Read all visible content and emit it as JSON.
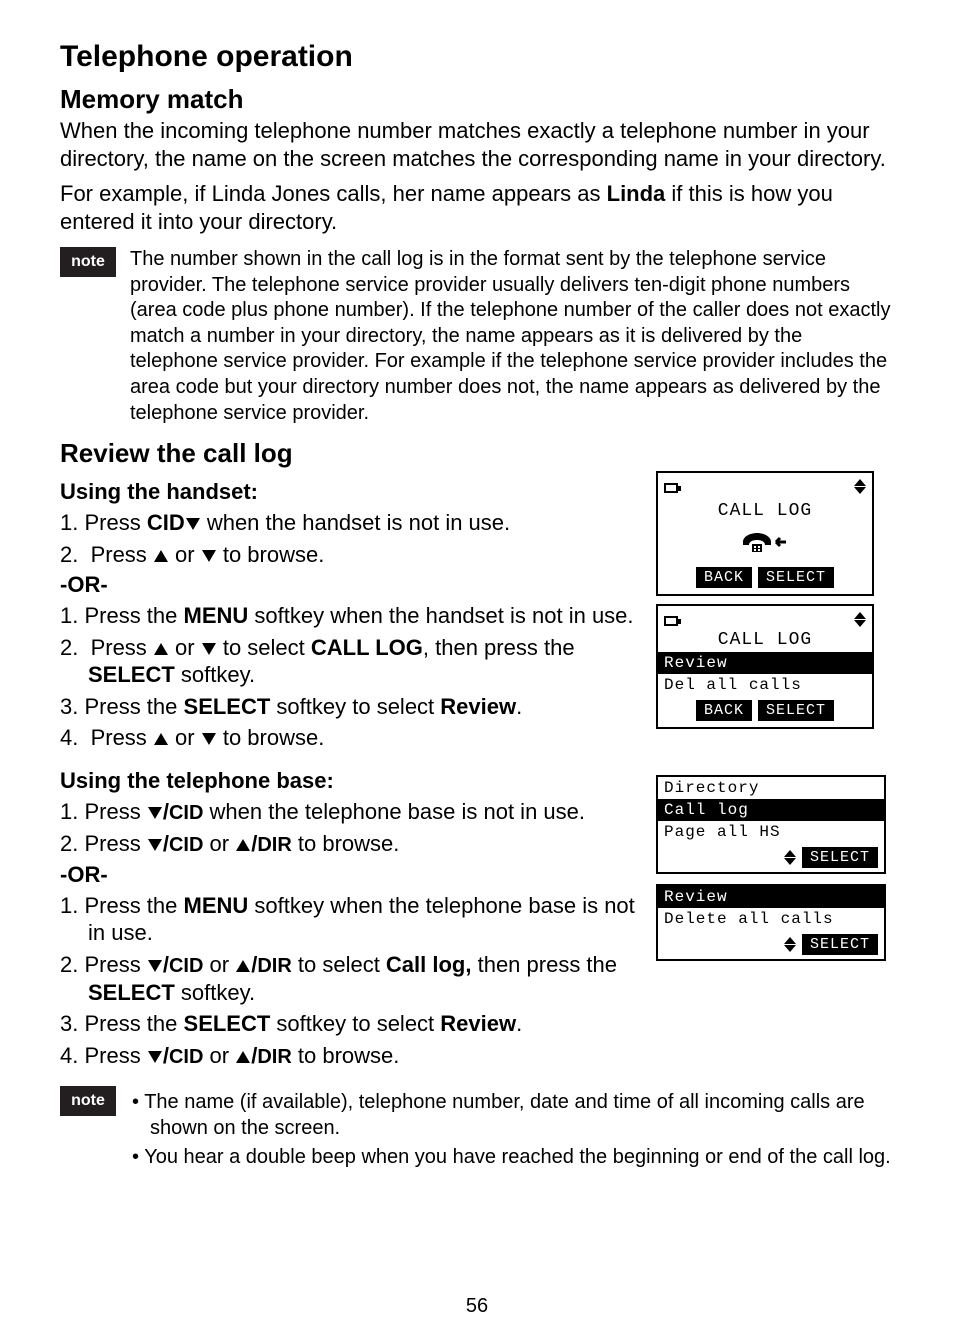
{
  "page_number": "56",
  "title": "Telephone operation",
  "section1": {
    "heading": "Memory match",
    "para1": "When the incoming telephone number matches exactly a telephone number in your directory, the name on the screen matches the corresponding name in your directory.",
    "para2_pre": "For example, if Linda Jones calls, her name appears as ",
    "para2_bold": "Linda",
    "para2_post": " if this is how you entered it into your directory."
  },
  "note1": {
    "label": "note",
    "text": "The number shown in the call log is in the format sent by the telephone service provider. The telephone service provider usually delivers ten-digit phone numbers (area code plus phone number). If the telephone number of the caller does not exactly match a number in your directory, the name appears as it is delivered by the telephone service provider. For example if the telephone service provider includes the area code but your directory number does not, the name appears as delivered by the telephone service provider."
  },
  "section2": {
    "heading": "Review the call log",
    "handset_heading": "Using the handset:",
    "h_step1_pre": "1.  Press ",
    "h_step1_bold": "CID",
    "h_step1_post": " when the handset is not in use.",
    "h_step2": "2.  Press ▲ or ▼ to browse.",
    "or": "-OR-",
    "h_alt1_pre": "1.  Press the ",
    "h_alt1_bold": "MENU",
    "h_alt1_post": " softkey when the handset is not in use.",
    "h_alt2_pre": "2.  Press ▲ or ▼ to select ",
    "h_alt2_bold": "CALL LOG",
    "h_alt2_mid": ", then press the ",
    "h_alt2_bold2": "SELECT",
    "h_alt2_post": " softkey.",
    "h_alt3_pre": "3.  Press the ",
    "h_alt3_bold": "SELECT",
    "h_alt3_mid": " softkey to select ",
    "h_alt3_bold2": "Review",
    "h_alt3_post": ".",
    "h_alt4": "4.  Press ▲ or ▼ to browse.",
    "base_heading": "Using the telephone base:",
    "b_step1_pre": "1.  Press ",
    "b_step1_key": "▼/CID",
    "b_step1_post": " when the telephone base is not in use.",
    "b_step2_pre": "2.  Press ",
    "b_step2_k1": "▼/CID",
    "b_step2_mid": " or ",
    "b_step2_k2": "▲/DIR",
    "b_step2_post": " to browse.",
    "b_alt1_pre": "1.  Press the ",
    "b_alt1_bold": "MENU",
    "b_alt1_post": " softkey when the telephone base is not in use.",
    "b_alt2_pre": "2.  Press ",
    "b_alt2_k1": "▼/CID",
    "b_alt2_mid1": " or ",
    "b_alt2_k2": "▲/DIR",
    "b_alt2_mid2": " to select ",
    "b_alt2_bold": "Call log,",
    "b_alt2_mid3": " then press the ",
    "b_alt2_bold2": "SELECT",
    "b_alt2_post": " softkey.",
    "b_alt3_pre": "3.  Press the ",
    "b_alt3_bold": "SELECT",
    "b_alt3_mid": " softkey to select ",
    "b_alt3_bold2": "Review",
    "b_alt3_post": ".",
    "b_alt4_pre": "4.  Press ",
    "b_alt4_k1": "▼/CID",
    "b_alt4_mid": " or ",
    "b_alt4_k2": "▲/DIR",
    "b_alt4_post": " to browse."
  },
  "note2": {
    "label": "note",
    "item1": "The name (if available), telephone number, date and time of all incoming calls are shown on the screen.",
    "item2": "You hear a double beep when you have reached the beginning or end of the call log."
  },
  "screens": {
    "s1_title": "CALL LOG",
    "s1_back": "BACK",
    "s1_select": "SELECT",
    "s2_title": "CALL LOG",
    "s2_row1": "Review",
    "s2_row2": "Del all calls",
    "s2_back": "BACK",
    "s2_select": "SELECT",
    "b1_row1": "Directory",
    "b1_row2": "Call log",
    "b1_row3": "Page all HS",
    "b1_select": "SELECT",
    "b2_row1": "Review",
    "b2_row2": "Delete all calls",
    "b2_select": "SELECT"
  }
}
